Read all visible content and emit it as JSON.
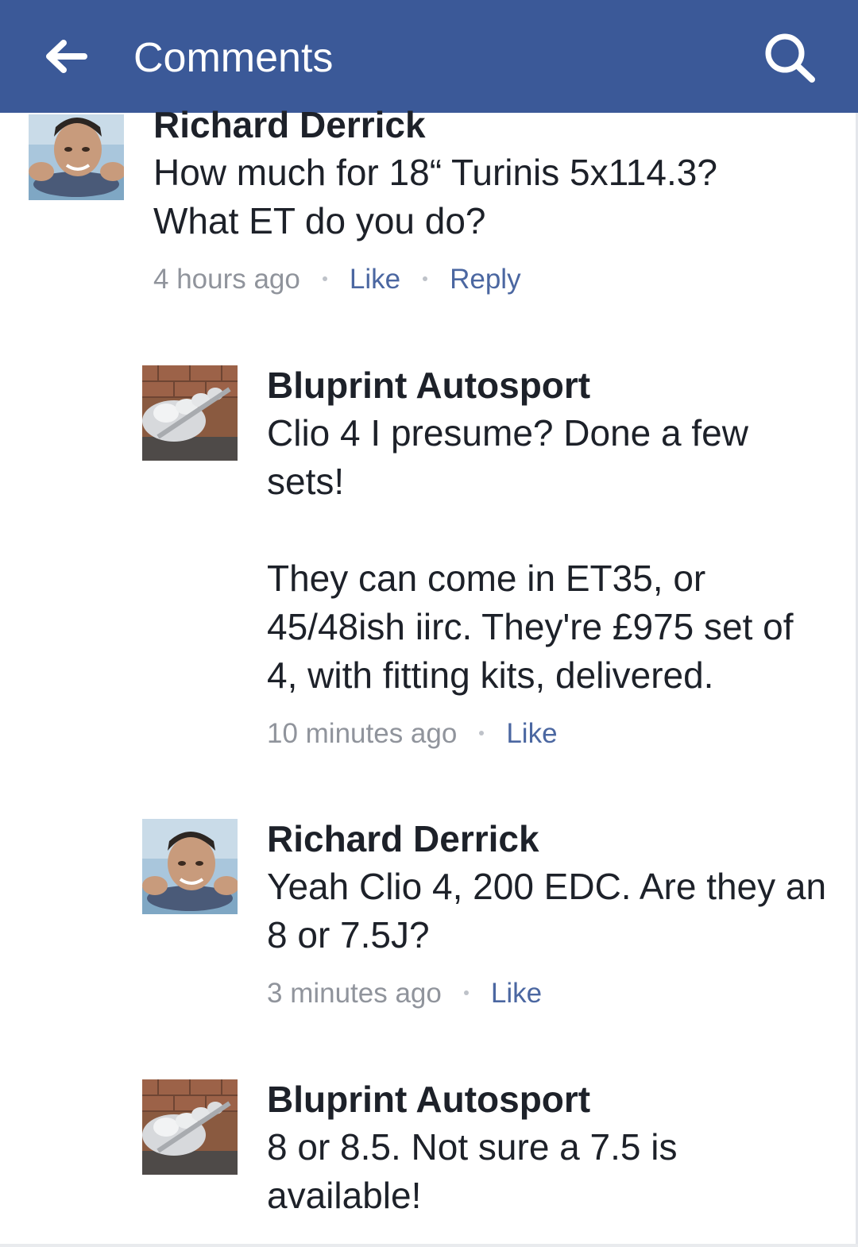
{
  "header": {
    "title": "Comments",
    "back_icon": "back-arrow-icon",
    "search_icon": "search-icon",
    "background_color": "#3b5998"
  },
  "comments": [
    {
      "author": "Richard Derrick",
      "text": "How much for 18“ Turinis 5x114.3? What ET do you do?",
      "time": "4 hours ago",
      "like_label": "Like",
      "reply_label": "Reply"
    },
    {
      "author": "Bluprint Autosport",
      "text": "Clio 4 I presume? Done a few sets!\n\nThey can come in ET35, or 45/48ish iirc. They're £975 set of 4, with fitting kits, delivered.",
      "time": "10 minutes ago",
      "like_label": "Like"
    },
    {
      "author": "Richard Derrick",
      "text": "Yeah Clio 4, 200 EDC. Are they an 8 or 7.5J?",
      "time": "3 minutes ago",
      "like_label": "Like"
    },
    {
      "author": "Bluprint Autosport",
      "text": "8 or 8.5. Not sure a 7.5 is available!"
    }
  ],
  "colors": {
    "link": "#4b67a1",
    "meta": "#90949c",
    "text": "#1d2129"
  }
}
